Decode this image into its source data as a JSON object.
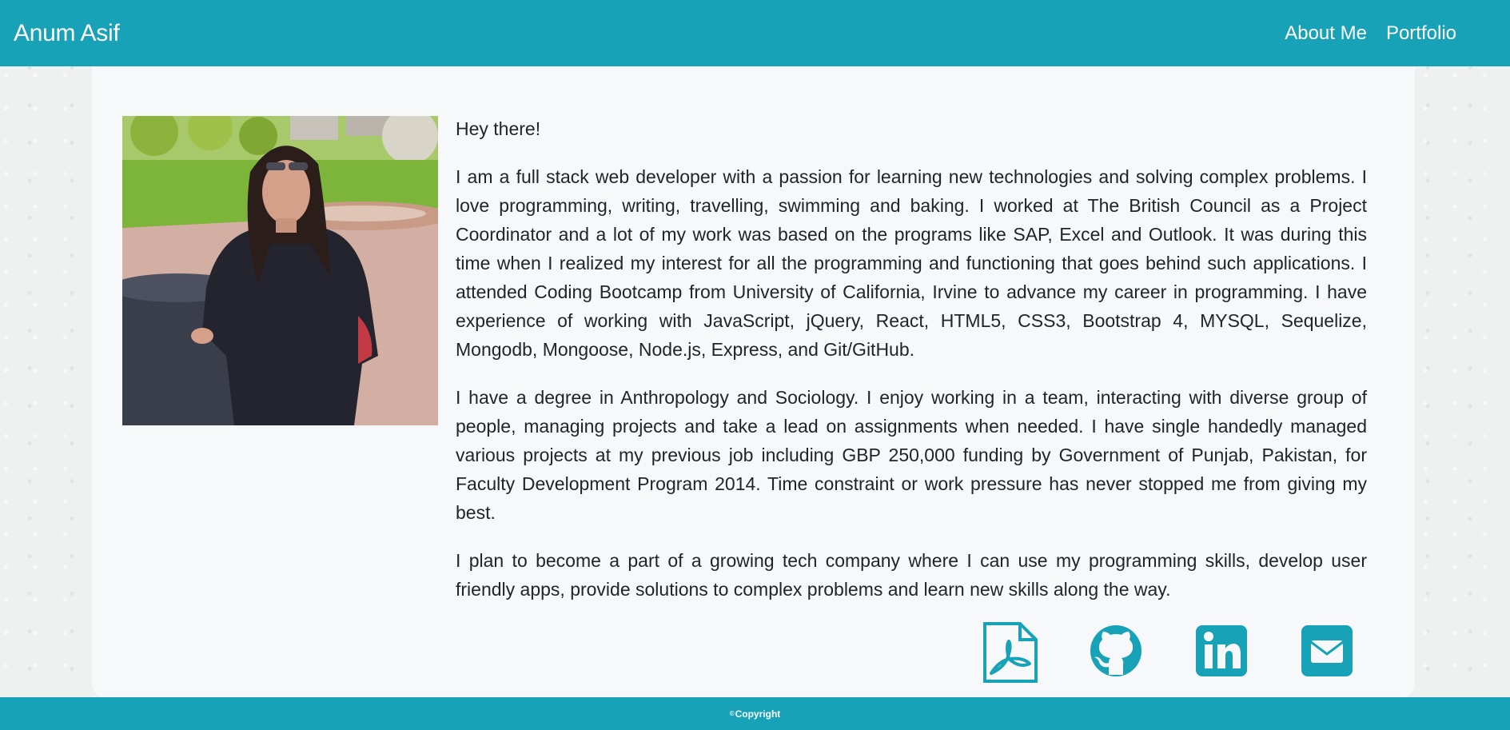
{
  "navbar": {
    "brand": "Anum Asif",
    "links": [
      {
        "label": "About Me"
      },
      {
        "label": "Portfolio"
      }
    ]
  },
  "about": {
    "greeting": "Hey there!",
    "paragraphs": [
      "I am a full stack web developer with a passion for learning new technologies and solving complex problems. I love programming, writing, travelling, swimming and baking. I worked at The British Council as a Project Coordinator and a lot of my work was based on the programs like SAP, Excel and Outlook. It was during this time when I realized my interest for all the programming and functioning that goes behind such applications. I attended Coding Bootcamp from University of California, Irvine to advance my career in programming. I have experience of working with JavaScript, jQuery, React, HTML5, CSS3, Bootstrap 4, MYSQL, Sequelize, Mongodb, Mongoose, Node.js, Express, and Git/GitHub.",
      "I have a degree in Anthropology and Sociology. I enjoy working in a team, interacting with diverse group of people, managing projects and take a lead on assignments when needed. I have single handedly managed various projects at my previous job including GBP 250,000 funding by Government of Punjab, Pakistan, for Faculty Development Program 2014. Time constraint or work pressure has never stopped me from giving my best.",
      "I plan to become a part of a growing tech company where I can use my programming skills, develop user friendly apps, provide solutions to complex problems and learn new skills along the way."
    ]
  },
  "social_icons": [
    {
      "icon": "pdf-resume-icon"
    },
    {
      "icon": "github-icon"
    },
    {
      "icon": "linkedin-icon"
    },
    {
      "icon": "envelope-icon"
    }
  ],
  "footer": {
    "symbol": "©",
    "text": "Copyright"
  },
  "colors": {
    "accent": "#17a2b8",
    "card": "#f6f8f9",
    "text": "#212529"
  }
}
